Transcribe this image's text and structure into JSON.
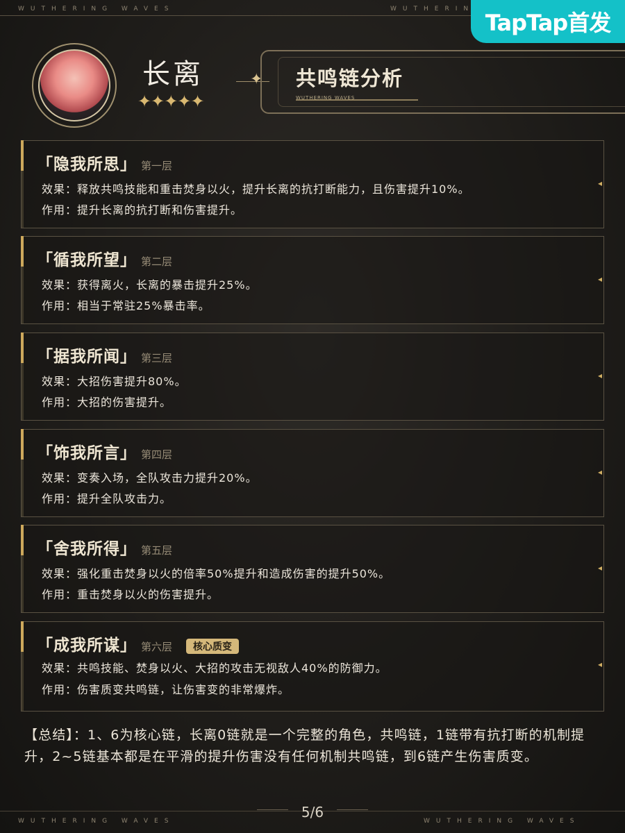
{
  "brand": {
    "top_left": "WUTHERING WAVES",
    "top_right": "WUTHERING WAVES",
    "bottom_left": "WUTHERING WAVES",
    "bottom_right": "WUTHERING WAVES"
  },
  "badge": {
    "text": "TapTap首发",
    "color": "#14c1c8"
  },
  "character": {
    "name": "长离",
    "stars": "✦✦✦✦✦",
    "avatar_icon": "character-portrait"
  },
  "section": {
    "title": "共鸣链分析",
    "subtitle": "WUTHERING WAVES"
  },
  "chains": [
    {
      "title": "「隐我所思」",
      "level": "第一层",
      "effect": "效果：释放共鸣技能和重击焚身以火，提升长离的抗打断能力，且伤害提升10%。",
      "role": "作用：提升长离的抗打断和伤害提升。"
    },
    {
      "title": "「循我所望」",
      "level": "第二层",
      "effect": "效果：获得离火，长离的暴击提升25%。",
      "role": "作用：相当于常驻25%暴击率。"
    },
    {
      "title": "「据我所闻」",
      "level": "第三层",
      "effect": "效果：大招伤害提升80%。",
      "role": "作用：大招的伤害提升。"
    },
    {
      "title": "「饰我所言」",
      "level": "第四层",
      "effect": "效果：变奏入场，全队攻击力提升20%。",
      "role": "作用：提升全队攻击力。"
    },
    {
      "title": "「舍我所得」",
      "level": "第五层",
      "effect": "效果：强化重击焚身以火的倍率50%提升和造成伤害的提升50%。",
      "role": "作用：重击焚身以火的伤害提升。"
    },
    {
      "title": "「成我所谋」",
      "level": "第六层",
      "tag": "核心质变",
      "effect": "效果：共鸣技能、焚身以火、大招的攻击无视敌人40%的防御力。",
      "role": "作用：伤害质变共鸣链，让伤害变的非常爆炸。"
    }
  ],
  "summary": "【总结】：1、6为核心链，长离0链就是一个完整的角色，共鸣链，1链带有抗打断的机制提升，2~5链基本都是在平滑的提升伤害没有任何机制共鸣链，到6链产生伤害质变。",
  "page": "5/6",
  "colors": {
    "gold": "#cda85c",
    "background": "#1f1d1a",
    "text": "#ece6db"
  }
}
